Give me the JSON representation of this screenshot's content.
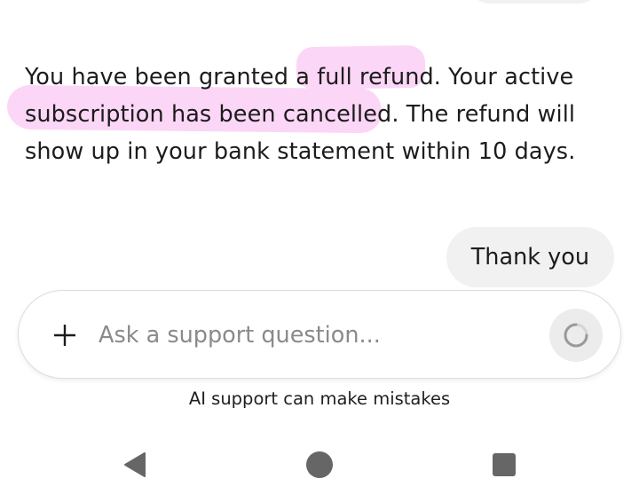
{
  "conversation": {
    "assistant_message": {
      "text_before_1": "You have been granted a ",
      "highlight_1": "full refund",
      "text_middle": ". Your active ",
      "highlight_2": "subscription has been cancelled",
      "text_after": ". The refund will show up in your bank statement within 10 days."
    },
    "user_message": "Thank you"
  },
  "composer": {
    "placeholder": "Ask a support question...",
    "add_icon": "plus-icon",
    "send_state": "loading-spinner-icon"
  },
  "disclaimer": "AI support can make mistakes",
  "navigation": {
    "back_icon": "back-triangle-icon",
    "home_icon": "home-circle-icon",
    "recents_icon": "recents-square-icon"
  },
  "colors": {
    "highlight": "#fbd6f6",
    "bubble": "#f1f1f1",
    "nav_icons": "#666666"
  }
}
